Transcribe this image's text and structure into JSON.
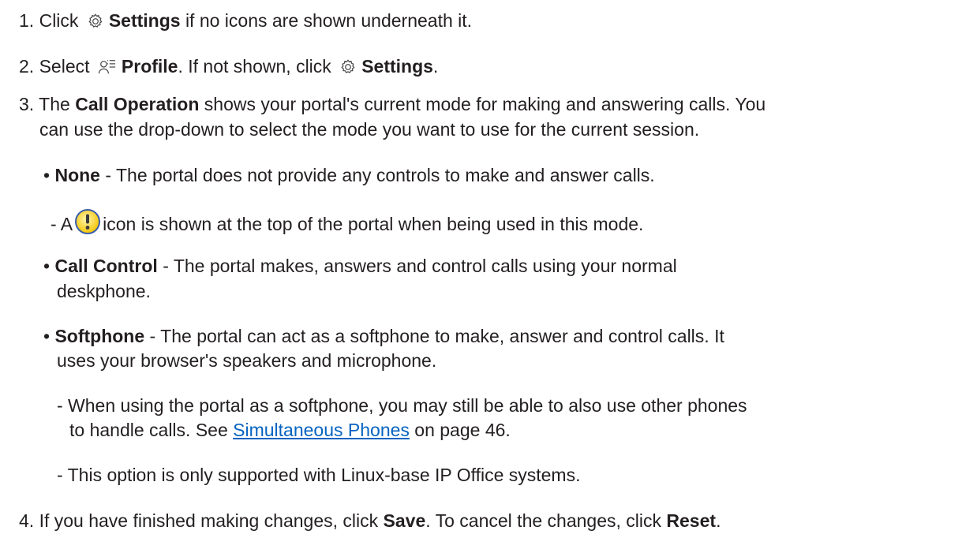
{
  "steps": [
    {
      "num": "1.",
      "click": "Click",
      "settings": "Settings",
      "rest": "if no icons are shown underneath it."
    },
    {
      "num": "2.",
      "select": "Select",
      "profile": "Profile",
      "mid": ". If not shown, click",
      "settings": "Settings",
      "end": "."
    },
    {
      "num": "3.",
      "the": "The",
      "call_operation": "Call Operation",
      "rest1": "shows your portal's current mode for making and answering calls. You",
      "line2": "can use the drop-down to select the mode you want to use for the current session."
    },
    {
      "num": "4.",
      "text1": "If you have finished making changes, click",
      "save": "Save",
      "text2": ". To cancel the changes, click",
      "reset": "Reset",
      "end": "."
    }
  ],
  "modes": {
    "none": {
      "bullet": "•",
      "name": "None",
      "desc": "- The portal does not provide any controls to make and answer calls.",
      "sub_prefix": "- A",
      "sub_suffix": "icon is shown at the top of the portal when being used in this mode."
    },
    "call_control": {
      "bullet": "•",
      "name": "Call Control",
      "desc1": "- The portal makes, answers and control calls using your normal",
      "desc2": "deskphone."
    },
    "softphone": {
      "bullet": "•",
      "name": "Softphone",
      "desc1": "- The portal can act as a softphone to make, answer and control calls. It",
      "desc2": "uses your browser's speakers and microphone.",
      "note1_line1": "- When using the portal as a softphone, you may still be able to also use other phones",
      "note1_line2_prefix": "to handle calls. See",
      "note1_link": "Simultaneous Phones",
      "note1_line2_suffix": "on page 46.",
      "note2": "- This option is only supported with Linux-base IP Office systems."
    }
  },
  "icons": {
    "settings": "gear-icon",
    "profile": "profile-list-icon",
    "warning": "exclamation-circle-icon",
    "warning_color": "#f5c400",
    "link_color": "#0563c1"
  }
}
